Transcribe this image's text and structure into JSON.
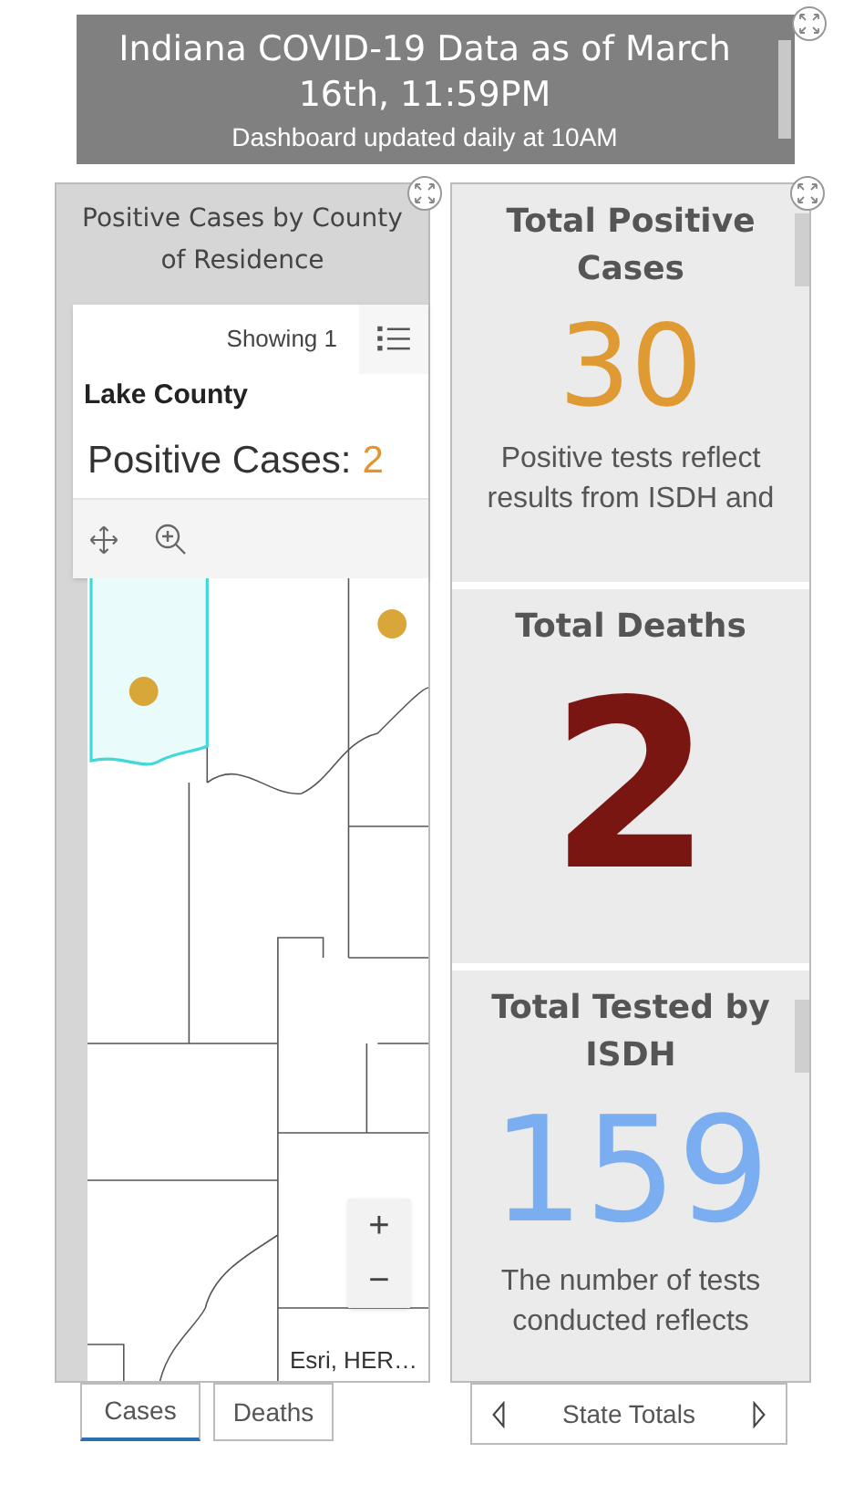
{
  "header": {
    "title": "Indiana COVID-19 Data as of March 16th, 11:59PM",
    "subtitle": "Dashboard updated daily at 10AM"
  },
  "county_panel": {
    "title": "Positive Cases by County of Residence",
    "popup": {
      "showing": "Showing 1",
      "name": "Lake County",
      "label": "Positive Cases:",
      "value": "2"
    },
    "map": {
      "kind": "picture",
      "zoom_in": "+",
      "zoom_out": "−",
      "attribution": "Esri, HER…"
    },
    "tabs": [
      {
        "label": "Cases",
        "selected": true
      },
      {
        "label": "Deaths",
        "selected": false
      }
    ]
  },
  "stats": [
    {
      "title": "Total Positive Cases",
      "value": "30",
      "color": "#e09a33",
      "note": "Positive tests reflect results from ISDH and"
    },
    {
      "title": "Total Deaths",
      "value": "2",
      "color": "#7a1612"
    },
    {
      "title": "Total Tested by ISDH",
      "value": "159",
      "color": "#7aaef0",
      "note": "The number of tests conducted reflects"
    }
  ],
  "stats_nav": {
    "label": "State Totals"
  }
}
